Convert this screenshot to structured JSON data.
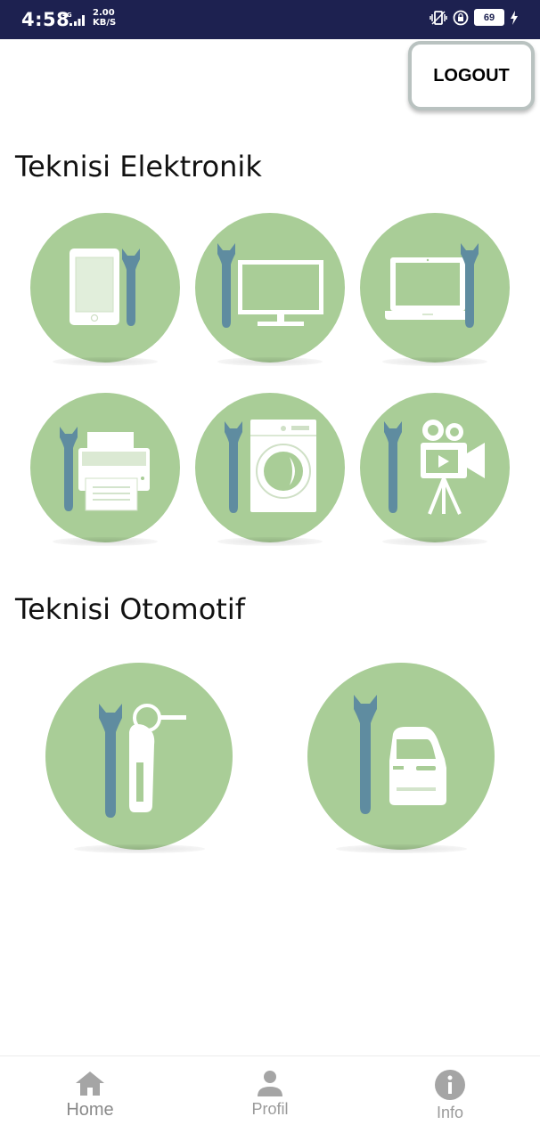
{
  "status_bar": {
    "time": "4:58",
    "network": "4G",
    "speed_value": "2.00",
    "speed_unit": "KB/S",
    "battery": "69"
  },
  "header": {
    "logout_label": "LOGOUT"
  },
  "sections": {
    "electronic": {
      "title": "Teknisi Elektronik",
      "items": [
        "smartphone-repair-icon",
        "tv-repair-icon",
        "laptop-repair-icon",
        "printer-repair-icon",
        "washing-machine-repair-icon",
        "video-camera-repair-icon"
      ]
    },
    "automotive": {
      "title": "Teknisi Otomotif",
      "items": [
        "motorcycle-repair-icon",
        "car-repair-icon"
      ]
    }
  },
  "bottom_nav": {
    "items": [
      {
        "label": "Home",
        "icon": "home-icon"
      },
      {
        "label": "Profil",
        "icon": "person-icon"
      },
      {
        "label": "Info",
        "icon": "info-icon"
      }
    ]
  },
  "colors": {
    "status_bar": "#1d2150",
    "circle": "#a9cd97",
    "wrench": "#5f8ca0",
    "device": "#ffffff",
    "nav_icon": "#a5a5a5"
  }
}
